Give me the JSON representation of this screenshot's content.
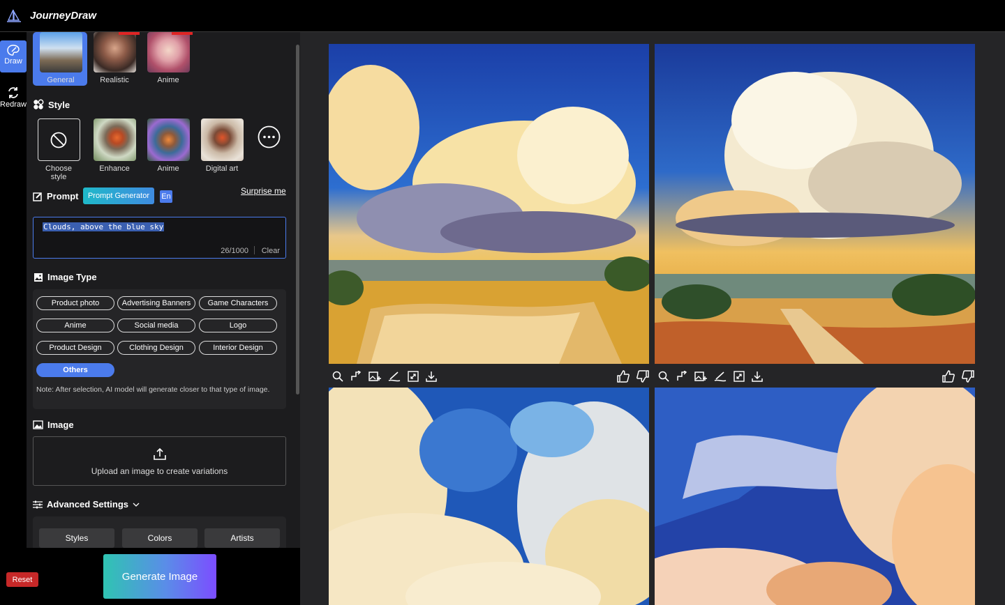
{
  "app": {
    "title": "JourneyDraw"
  },
  "rail": {
    "draw": "Draw",
    "redraw": "Redraw"
  },
  "models": [
    {
      "label": "General"
    },
    {
      "label": "Realistic"
    },
    {
      "label": "Anime"
    }
  ],
  "style": {
    "title": "Style",
    "items": [
      {
        "label": "Choose style"
      },
      {
        "label": "Enhance"
      },
      {
        "label": "Anime"
      },
      {
        "label": "Digital art"
      }
    ]
  },
  "prompt": {
    "title": "Prompt",
    "generator_label": "Prompt Generator",
    "lang_label": "En",
    "surprise_label": "Surprise me",
    "value": "Clouds, above the blue sky",
    "counter": "26/1000",
    "clear_label": "Clear"
  },
  "image_type": {
    "title": "Image Type",
    "chips": [
      "Product photo",
      "Advertising Banners",
      "Game Characters",
      "Anime",
      "Social media",
      "Logo",
      "Product Design",
      "Clothing Design",
      "Interior Design",
      "Others"
    ],
    "selected": "Others",
    "note": "Note: After selection, AI model will generate closer to that type of image."
  },
  "image": {
    "title": "Image",
    "upload_label": "Upload an image to create variations"
  },
  "advanced": {
    "title": "Advanced Settings",
    "buttons": [
      "Styles",
      "Colors",
      "Artists"
    ]
  },
  "actions": {
    "reset_label": "Reset",
    "generate_label": "Generate Image"
  },
  "colors": {
    "accent": "#4b7bec",
    "danger": "#c62828",
    "panel": "#1c1c1e",
    "gallery": "#252527"
  }
}
